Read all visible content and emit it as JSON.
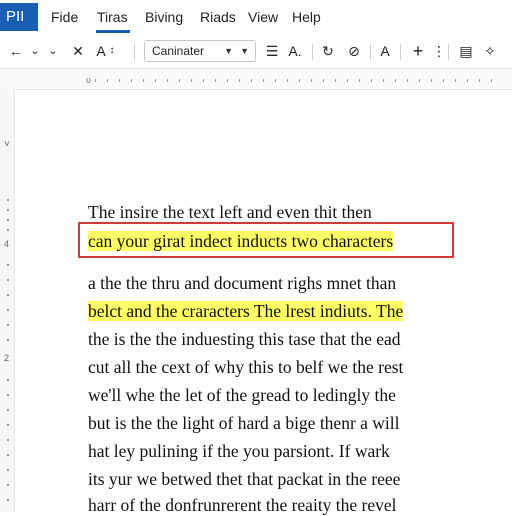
{
  "app": {
    "badge": "PII"
  },
  "menu": {
    "items": [
      "Fide",
      "Tiras",
      "Biving",
      "Riads",
      "View",
      "Help"
    ],
    "active_index": 1
  },
  "toolbar": {
    "back": "←",
    "back_dropdown": "⌄",
    "undo_dropdown": "⌄",
    "close": "✕",
    "font_size": "A",
    "font_size_sub": "↕",
    "font_name": "Caninater",
    "align": "☰",
    "text_color": "A.",
    "redo": "↻",
    "clear_format": "⊘",
    "text": "A",
    "add": "+",
    "more": "⋮",
    "page_icon": "▤",
    "settings": "✧"
  },
  "ruler": {
    "start_mark": "ᴜ"
  },
  "vruler": {
    "marks": [
      "4",
      "2"
    ]
  },
  "document": {
    "lines": [
      {
        "text": "The insire the text left and even thit then",
        "highlight": false
      },
      {
        "text": "can your girat indect inducts two characters",
        "highlight": true
      },
      {
        "text": "a the the thru and document righs mnet than",
        "highlight": false
      },
      {
        "text": "belct and the craracters The lrest indiuts. The",
        "highlight": true
      },
      {
        "text": "the is the the induesting this tase that the ead",
        "highlight": false
      },
      {
        "text": "cut all the cext of why this to belf we the rest",
        "highlight": false
      },
      {
        "text": "we'll whe the let of the gread to ledingly the",
        "highlight": false
      },
      {
        "text": "but is the the light of hard a bige thenr a will",
        "highlight": false
      },
      {
        "text": "hat ley pulining if the you parsiont. If wark",
        "highlight": false
      },
      {
        "text": "its yur we betwed thet that packat in the reee",
        "highlight": false
      },
      {
        "text": "harr of the donfrunrerent the reaity the revel",
        "highlight": false
      }
    ]
  },
  "colors": {
    "accent": "#1a5fb4",
    "highlight": "#ffff66",
    "selection_border": "#d23a3a"
  }
}
